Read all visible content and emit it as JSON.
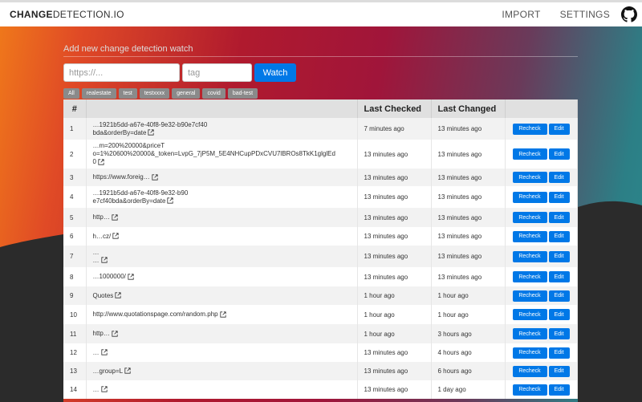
{
  "brand": {
    "bold": "CHANGE",
    "rest": "DETECTION.IO"
  },
  "nav": {
    "import": "IMPORT",
    "settings": "SETTINGS"
  },
  "icons": {
    "github": "github-icon",
    "external": "external-link-icon"
  },
  "colors": {
    "accent": "#0078e7",
    "tag_bg": "#8a8a8a"
  },
  "add_form": {
    "title": "Add new change detection watch",
    "url_placeholder": "https://...",
    "tag_placeholder": "tag",
    "watch_label": "Watch"
  },
  "tags": [
    "All",
    "realestate",
    "test",
    "testxxxx",
    "general",
    "covid",
    "bad-test"
  ],
  "table": {
    "headers": {
      "num": "#",
      "url": "",
      "last_checked": "Last Checked",
      "last_changed": "Last Changed",
      "actions": ""
    },
    "recheck_label": "Recheck",
    "edit_label": "Edit",
    "rows": [
      {
        "num": "1",
        "lines": [
          "…1921b5dd-a67e-40f8-9e32-b90e7cf40",
          "bda&orderBy=date"
        ],
        "checked": "7 minutes ago",
        "changed": "13 minutes ago"
      },
      {
        "num": "2",
        "lines": [
          "…m=200%20000&priceT",
          "o=1%20600%20000&_token=LvpG_7jP5M_5E4NHCupPDxCVU7lBROs8TkK1glglEd",
          "0"
        ],
        "checked": "13 minutes ago",
        "changed": "13 minutes ago"
      },
      {
        "num": "3",
        "lines": [
          "https://www.foreig…"
        ],
        "checked": "13 minutes ago",
        "changed": "13 minutes ago"
      },
      {
        "num": "4",
        "lines": [
          "…1921b5dd-a67e-40f8-9e32-b90",
          "e7cf40bda&orderBy=date"
        ],
        "checked": "13 minutes ago",
        "changed": "13 minutes ago"
      },
      {
        "num": "5",
        "lines": [
          "http…"
        ],
        "checked": "13 minutes ago",
        "changed": "13 minutes ago"
      },
      {
        "num": "6",
        "lines": [
          "h…cz/"
        ],
        "checked": "13 minutes ago",
        "changed": "13 minutes ago"
      },
      {
        "num": "7",
        "lines": [
          "…",
          "…"
        ],
        "checked": "13 minutes ago",
        "changed": "13 minutes ago"
      },
      {
        "num": "8",
        "lines": [
          "…1000000/"
        ],
        "checked": "13 minutes ago",
        "changed": "13 minutes ago"
      },
      {
        "num": "9",
        "lines": [
          "Quotes"
        ],
        "checked": "1 hour ago",
        "changed": "1 hour ago"
      },
      {
        "num": "10",
        "lines": [
          "http://www.quotationspage.com/random.php"
        ],
        "checked": "1 hour ago",
        "changed": "1 hour ago"
      },
      {
        "num": "11",
        "lines": [
          "http…"
        ],
        "checked": "1 hour ago",
        "changed": "3 hours ago"
      },
      {
        "num": "12",
        "lines": [
          "…"
        ],
        "checked": "13 minutes ago",
        "changed": "4 hours ago"
      },
      {
        "num": "13",
        "lines": [
          "…group=L"
        ],
        "checked": "13 minutes ago",
        "changed": "6 hours ago"
      },
      {
        "num": "14",
        "lines": [
          "…"
        ],
        "checked": "13 minutes ago",
        "changed": "1 day ago"
      }
    ]
  }
}
